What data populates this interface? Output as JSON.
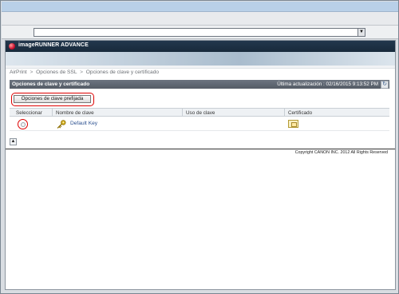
{
  "browser": {
    "address_value": "",
    "address_dropdown_icon": "▼"
  },
  "app": {
    "title": "imageRUNNER ADVANCE",
    "logo_icon": "canon-logo-icon"
  },
  "breadcrumb": {
    "items": [
      "AirPrint",
      "Opciones de SSL",
      "Opciones de clave y certificado"
    ],
    "separator": ">"
  },
  "section": {
    "title": "Opciones de clave y certificado",
    "last_update": "Última actualización : 02/16/2015 9:13:52 PM",
    "refresh_icon": "refresh-icon"
  },
  "actions": {
    "preset_key_button": "Opciones de clave prefijada"
  },
  "table": {
    "headers": [
      "Seleccionar",
      "Nombre de clave",
      "Uso de clave",
      "Certificado"
    ],
    "rows": [
      {
        "key_name": "Default Key",
        "key_usage": "",
        "certificate_icon": "certificate-icon"
      }
    ]
  },
  "footer": {
    "page_top_icon": "page-top-icon",
    "copyright": "Copyright CANON INC. 2012 All Rights Reserved"
  },
  "colors": {
    "highlight": "#dd0000",
    "header_dark": "#23384d",
    "section_bar": "#555c66",
    "link": "#2a4f8f"
  }
}
